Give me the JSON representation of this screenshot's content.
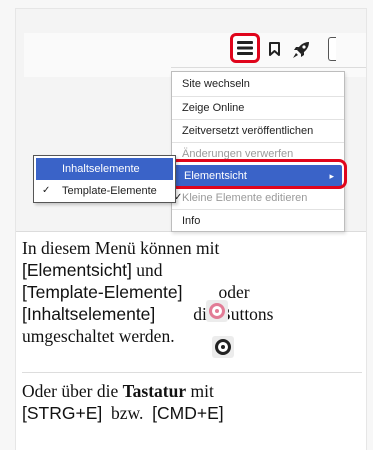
{
  "menu": {
    "items": [
      {
        "label": "Site wechseln",
        "state": "normal"
      },
      {
        "label": "Zeige Online",
        "state": "normal"
      },
      {
        "label": "Zeitversetzt veröffentlichen",
        "state": "normal"
      },
      {
        "label": "Änderungen verwerfen",
        "state": "disabled"
      },
      {
        "label": "Elementsicht",
        "state": "active",
        "submenu_arrow": "▸"
      },
      {
        "label": "Kleine Elemente editieren",
        "state": "disabled",
        "checked": true
      },
      {
        "label": "Info",
        "state": "normal"
      }
    ],
    "check_mark": "✓"
  },
  "submenu": {
    "items": [
      {
        "label": "Inhaltselemente",
        "state": "active"
      },
      {
        "label": "Template-Elemente",
        "state": "checked"
      }
    ]
  },
  "toolbar": {
    "icons": [
      "hamburger-menu-icon",
      "bookmark-icon",
      "rocket-icon"
    ],
    "highlight_color": "#e0051c"
  },
  "text": {
    "line1": "In diesem Menü können mit",
    "line2": "[Elementsicht]",
    "line2b": " und",
    "line3": "[Template-Elemente]",
    "line3b": "oder",
    "line4": "[Inhaltselemente]",
    "line4b": "die Buttons",
    "line5": "umgeschaltet  werden.",
    "p2_a": "Oder über die ",
    "p2_bold": "Tastatur",
    "p2_b": " mit",
    "p2_line2a": "[STRG+E]",
    "p2_line2b": "  bzw.  ",
    "p2_line2c": "[CMD+E]"
  },
  "colors": {
    "accent_blue": "#3a63c8",
    "pink_icon": "#e27c96",
    "dark_icon": "#222222"
  }
}
